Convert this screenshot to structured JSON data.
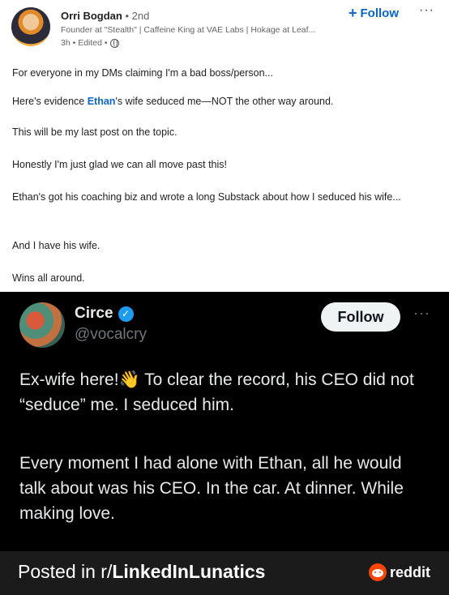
{
  "linkedin": {
    "author_name": "Orri Bogdan",
    "degree": " • 2nd",
    "headline": "Founder at \"Stealth\" | Caffeine King at VAE Labs | Hokage at Leaf...",
    "time": "3h • Edited •",
    "follow_label": "Follow",
    "follow_icon": "plus-icon",
    "more_label": "···",
    "post": {
      "p1": "For everyone in my DMs claiming I'm a bad boss/person...",
      "p2_before": "Here's evidence ",
      "p2_mention": "Ethan",
      "p2_after": "'s wife seduced me—NOT the other way around.",
      "p3": "This will be my last post on the topic.",
      "p4": "Honestly I'm just glad we can all move past this!",
      "p5": "Ethan's got his coaching biz and wrote a long Substack about how I seduced his wife...",
      "p6": "And I have his wife.",
      "p7": "Wins all around."
    }
  },
  "tweet": {
    "name": "Circe",
    "verified_mark": "✓",
    "handle": "@vocalcry",
    "follow_label": "Follow",
    "more_label": "···",
    "para1_before": "Ex-wife here!",
    "para1_emoji": "👋",
    "para1_after": " To clear the record, his CEO did not “seduce” me. I seduced him.",
    "para2": "Every moment I had alone with Ethan, all he would talk about was his CEO. In the car. At dinner. While making love."
  },
  "footer": {
    "posted_in": "Posted in r/",
    "subreddit": "LinkedInLunatics",
    "logo_text": "reddit"
  },
  "colors": {
    "linkedin_blue": "#0a66c2",
    "twitter_blue": "#1d9bf0",
    "reddit_orange": "#ff4500"
  }
}
